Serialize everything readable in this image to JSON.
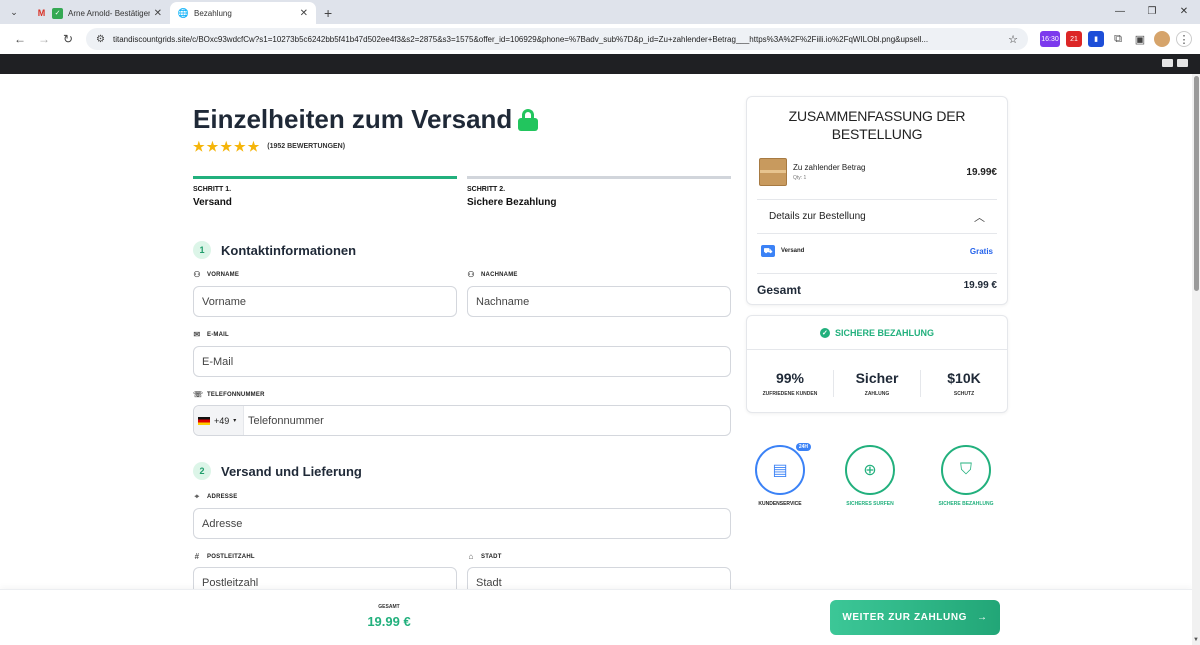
{
  "browser": {
    "tabs": [
      {
        "title": "Arne Arnold- Bestätigen Si",
        "active": false
      },
      {
        "title": "Bezahlung",
        "active": true
      }
    ],
    "url": "titandiscountgrids.site/c/BOxc93wdcfCw?s1=10273b5c6242bb5f41b47d502ee4f3&s2=2875&s3=1575&offer_id=106929&phone=%7Badv_sub%7D&p_id=Zu+zahlender+Betrag___https%3A%2F%2Fiili.io%2FqWILObl.png&upsell...",
    "ext_badges": [
      "16:30",
      "21"
    ]
  },
  "page": {
    "heading": "Einzelheiten zum Versand",
    "rating_count": "(1952 BEWERTUNGEN)",
    "steps": [
      {
        "label": "SCHRITT 1.",
        "name": "Versand",
        "active": true
      },
      {
        "label": "SCHRITT 2.",
        "name": "Sichere Bezahlung",
        "active": false
      }
    ],
    "section1": {
      "num": "1",
      "title": "Kontaktinformationen"
    },
    "section2": {
      "num": "2",
      "title": "Versand und Lieferung"
    },
    "fields": {
      "vorname": {
        "label": "VORNAME",
        "placeholder": "Vorname"
      },
      "nachname": {
        "label": "NACHNAME",
        "placeholder": "Nachname"
      },
      "email": {
        "label": "E-MAIL",
        "placeholder": "E-Mail"
      },
      "telefon": {
        "label": "TELEFONNUMMER",
        "placeholder": "Telefonnummer",
        "prefix": "+49"
      },
      "adresse": {
        "label": "ADRESSE",
        "placeholder": "Adresse"
      },
      "plz": {
        "label": "POSTLEITZAHL",
        "placeholder": "Postleitzahl"
      },
      "stadt": {
        "label": "STADT",
        "placeholder": "Stadt"
      }
    }
  },
  "summary": {
    "title": "ZUSAMMENFASSUNG DER BESTELLUNG",
    "item_name": "Zu zahlender Betrag",
    "item_qty": "Qty: 1",
    "item_price": "19.99€",
    "details_label": "Details zur Bestellung",
    "shipping_label": "Versand",
    "shipping_value": "Gratis",
    "total_label": "Gesamt",
    "total_value": "19.99 €"
  },
  "secure": {
    "header": "SICHERE BEZAHLUNG",
    "stats": [
      {
        "value": "99%",
        "caption": "ZUFRIEDENE KUNDEN"
      },
      {
        "value": "Sicher",
        "caption": "ZAHLUNG"
      },
      {
        "value": "$10K",
        "caption": "SCHUTZ"
      }
    ]
  },
  "badges": [
    {
      "caption": "KUNDENSERVICE",
      "tag": "24H"
    },
    {
      "caption": "SICHERES SURFEN"
    },
    {
      "caption": "SICHERE BEZAHLUNG"
    }
  ],
  "footer": {
    "total_label": "GESAMT",
    "total_value": "19.99 €",
    "cta": "WEITER ZUR ZAHLUNG"
  },
  "colors": {
    "accent": "#22b07d",
    "link": "#2563eb",
    "star": "#f5b50a"
  }
}
